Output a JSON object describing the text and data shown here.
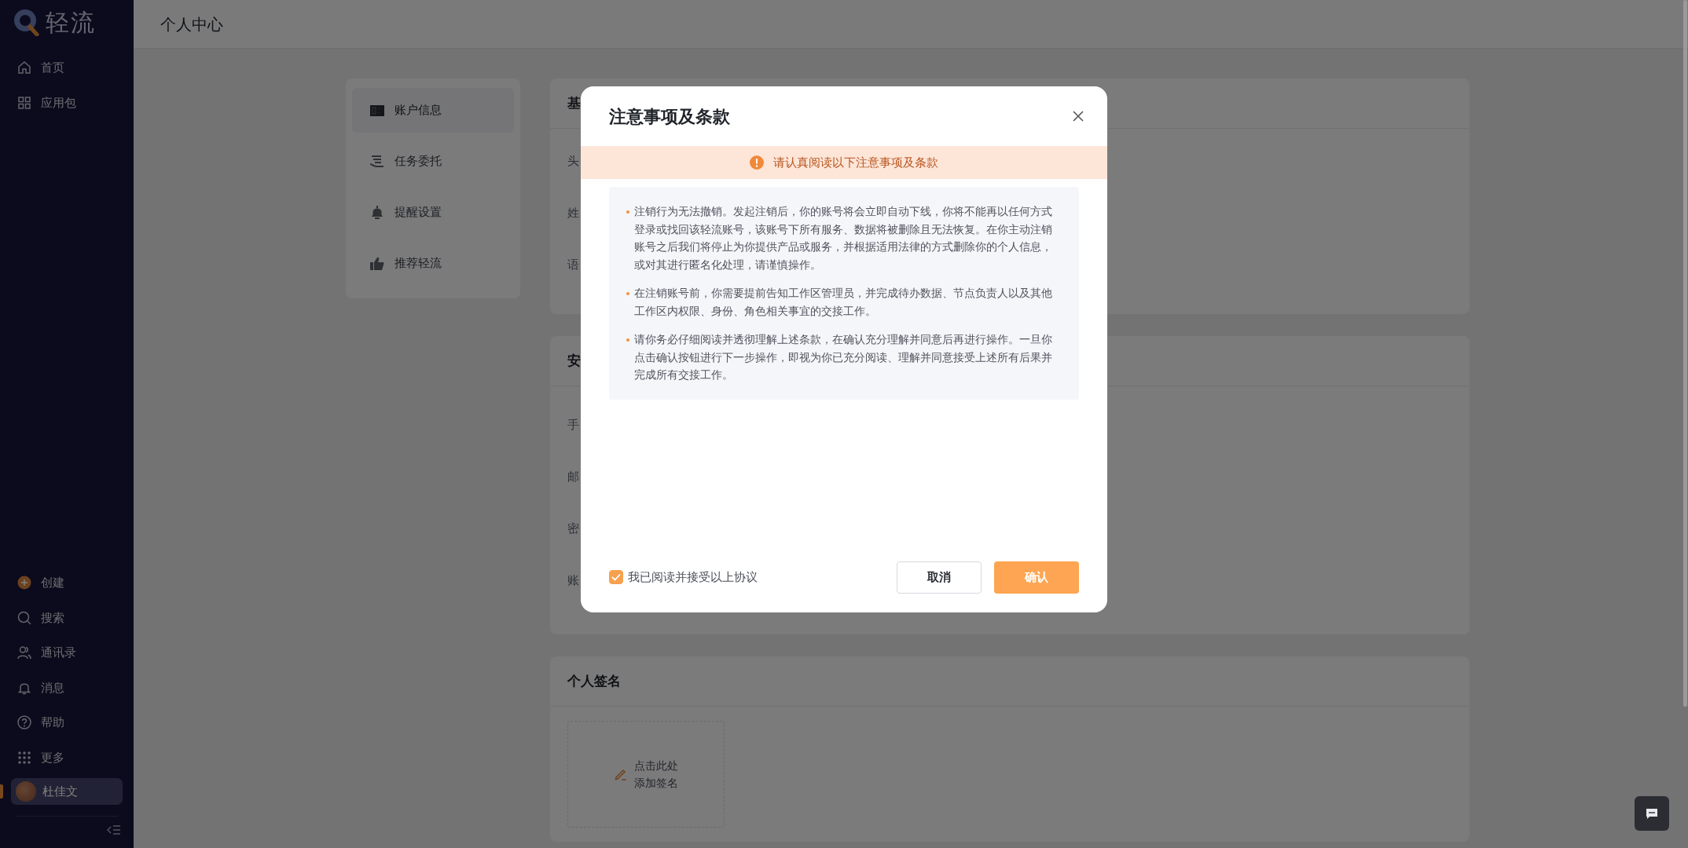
{
  "sidebar": {
    "logo_text": "轻流",
    "top_items": [
      {
        "kind": "home",
        "label": "首页"
      },
      {
        "kind": "grid",
        "label": "应用包"
      }
    ],
    "bottom_items": [
      {
        "kind": "create",
        "label": "创建"
      },
      {
        "kind": "search",
        "label": "搜索"
      },
      {
        "kind": "contacts",
        "label": "通讯录"
      },
      {
        "kind": "bell",
        "label": "消息"
      },
      {
        "kind": "help",
        "label": "帮助"
      },
      {
        "kind": "more",
        "label": "更多"
      }
    ],
    "user": {
      "name": "杜佳文",
      "selected": true
    }
  },
  "header": {
    "title": "个人中心"
  },
  "settings_menu": [
    {
      "kind": "card",
      "label": "账户信息",
      "selected": true
    },
    {
      "kind": "delegate",
      "label": "任务委托",
      "selected": false
    },
    {
      "kind": "bell",
      "label": "提醒设置",
      "selected": false
    },
    {
      "kind": "thumb",
      "label": "推荐轻流",
      "selected": false
    }
  ],
  "basic_card": {
    "title": "基",
    "rows": [
      "头",
      "姓",
      "语"
    ]
  },
  "security_card": {
    "title": "安",
    "rows": [
      "手",
      "邮",
      "密",
      "账"
    ]
  },
  "signature_card": {
    "title": "个人签名",
    "lines": [
      "点击此处",
      "添加签名"
    ]
  },
  "dialog": {
    "title": "注意事项及条款",
    "notice": "请认真阅读以下注意事项及条款",
    "terms": [
      "注销行为无法撤销。发起注销后，你的账号将会立即自动下线，你将不能再以任何方式登录或找回该轻流账号，该账号下所有服务、数据将被删除且无法恢复。在你主动注销账号之后我们将停止为你提供产品或服务，并根据适用法律的方式删除你的个人信息，或对其进行匿名化处理，请谨慎操作。",
      "在注销账号前，你需要提前告知工作区管理员，并完成待办数据、节点负责人以及其他工作区内权限、身份、角色相关事宜的交接工作。",
      "请你务必仔细阅读并透彻理解上述条款，在确认充分理解并同意后再进行操作。一旦你点击确认按钮进行下一步操作，即视为你已充分阅读、理解并同意接受上述所有后果并完成所有交接工作。"
    ],
    "agreement": {
      "label": "我已阅读并接受以上协议",
      "checked": true
    },
    "cancel": "取消",
    "confirm": {
      "label": "确认",
      "disabled": false
    }
  }
}
